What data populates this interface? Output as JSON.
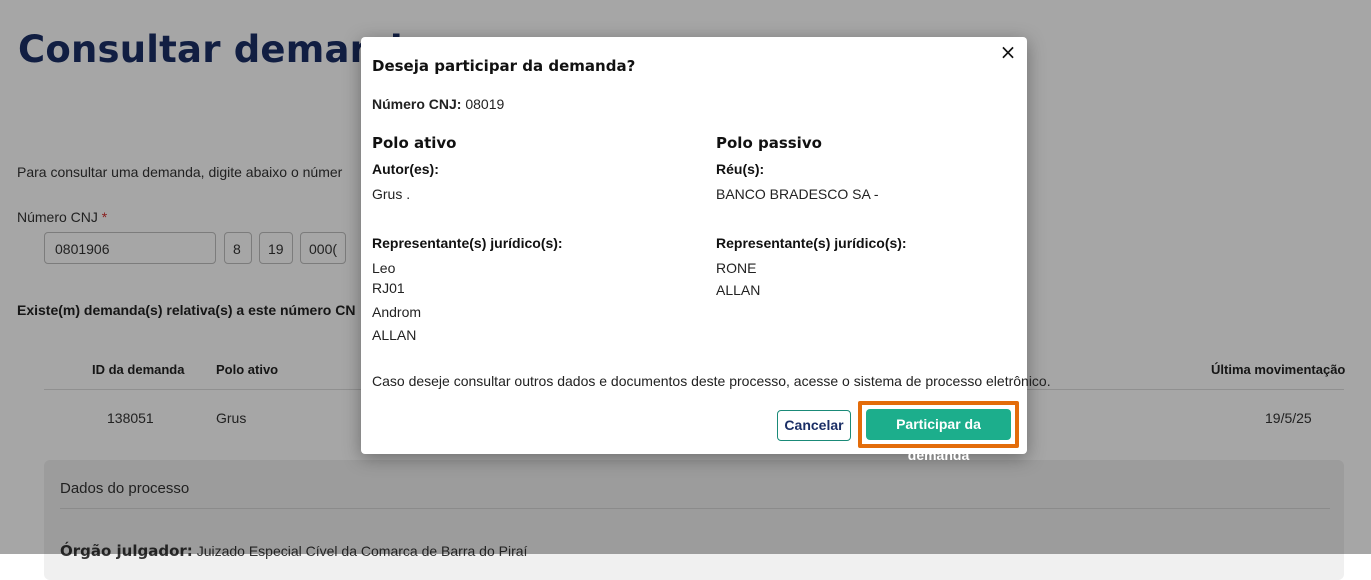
{
  "page": {
    "title": "Consultar demanda pr",
    "intro": "Para consultar uma demanda, digite abaixo o númer",
    "cnj_label": "Número CNJ",
    "required_mark": "*",
    "cnj_parts": [
      "0801906",
      "",
      "8",
      "19",
      "000("
    ],
    "exists_text": "Existe(m) demanda(s) relativa(s) a este número CN",
    "table": {
      "headers": {
        "id": "ID da demanda",
        "polo": "Polo ativo",
        "ultima": "Última movimentação"
      },
      "row": {
        "id": "138051",
        "polo": "Grus",
        "ultima": "19/5/25"
      }
    },
    "dados": {
      "title": "Dados do processo",
      "orgao_label": "Órgão julgador:",
      "orgao_value": "Juizado Especial Cível da Comarca de Barra do Piraí"
    }
  },
  "modal": {
    "close": "×",
    "title": "Deseja participar da demanda?",
    "cnj_label": "Número CNJ:",
    "cnj_value": "08019",
    "polo_ativo": {
      "heading": "Polo ativo",
      "autor_label": "Autor(es):",
      "autor": "Grus .",
      "rep_label": "Representante(s) jurídico(s):",
      "reps": [
        "Leo",
        "RJ01",
        "Androm",
        "ALLAN"
      ]
    },
    "polo_passivo": {
      "heading": "Polo passivo",
      "reu_label": "Réu(s):",
      "reu": "BANCO BRADESCO SA -",
      "rep_label": "Representante(s) jurídico(s):",
      "reps": [
        "RONE",
        "ALLAN"
      ]
    },
    "note": "Caso deseje consultar outros dados e documentos deste processo, acesse o sistema de processo eletrônico.",
    "cancel_label": "Cancelar",
    "participar_label": "Participar da demanda"
  },
  "colors": {
    "title": "#1b2f66",
    "primary_button": "#1cae8c",
    "highlight": "#e36c0a",
    "required": "#d32f2f"
  }
}
